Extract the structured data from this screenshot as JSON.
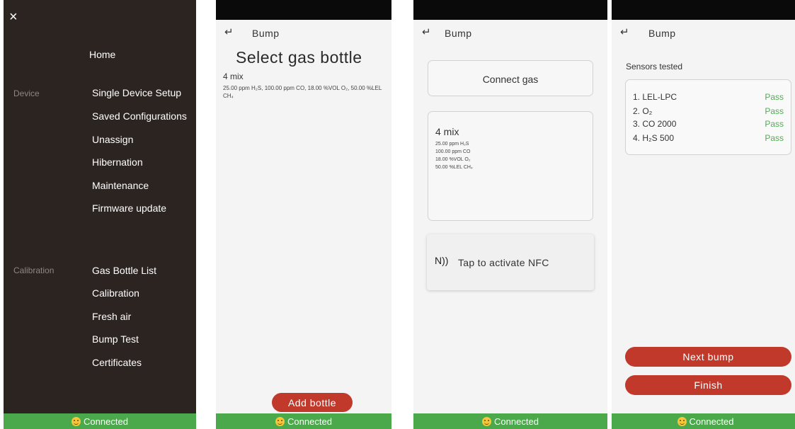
{
  "status": {
    "label": "Connected"
  },
  "menu": {
    "close_icon": "×",
    "home": "Home",
    "device_label": "Device",
    "device_items": [
      "Single Device Setup",
      "Saved Configurations",
      "Unassign",
      "Hibernation",
      "Maintenance",
      "Firmware update"
    ],
    "calibration_label": "Calibration",
    "calibration_items": [
      "Gas Bottle List",
      "Calibration",
      "Fresh air",
      "Bump Test",
      "Certificates"
    ]
  },
  "header": {
    "back_icon": "↵",
    "title": "Bump"
  },
  "select_bottle": {
    "title": "Select gas bottle",
    "mix_name": "4 mix",
    "mix_detail": "25.00 ppm H₂S, 100.00 ppm CO, 18.00 %VOL O₂, 50.00 %LEL CH₄",
    "add_button": "Add bottle"
  },
  "connect": {
    "connect_label": "Connect gas",
    "mix_name": "4 mix",
    "mix_lines": [
      "25.00 ppm H₂S",
      "100.00 ppm CO",
      "18.00 %VOL O₂",
      "50.00 %LEL CH₄"
    ],
    "nfc_icon": "N))",
    "nfc_label": "Tap to activate NFC"
  },
  "results": {
    "title": "Sensors tested",
    "rows": [
      {
        "name": "1. LEL-LPC",
        "result": "Pass"
      },
      {
        "name": "2. O₂",
        "result": "Pass"
      },
      {
        "name": "3. CO 2000",
        "result": "Pass"
      },
      {
        "name": "4. H₂S 500",
        "result": "Pass"
      }
    ],
    "next_button": "Next bump",
    "finish_button": "Finish"
  },
  "colors": {
    "accent_red": "#c0392b",
    "status_green": "#4ba84b",
    "pass_green": "#4caf50",
    "menu_bg": "#2c2421"
  }
}
